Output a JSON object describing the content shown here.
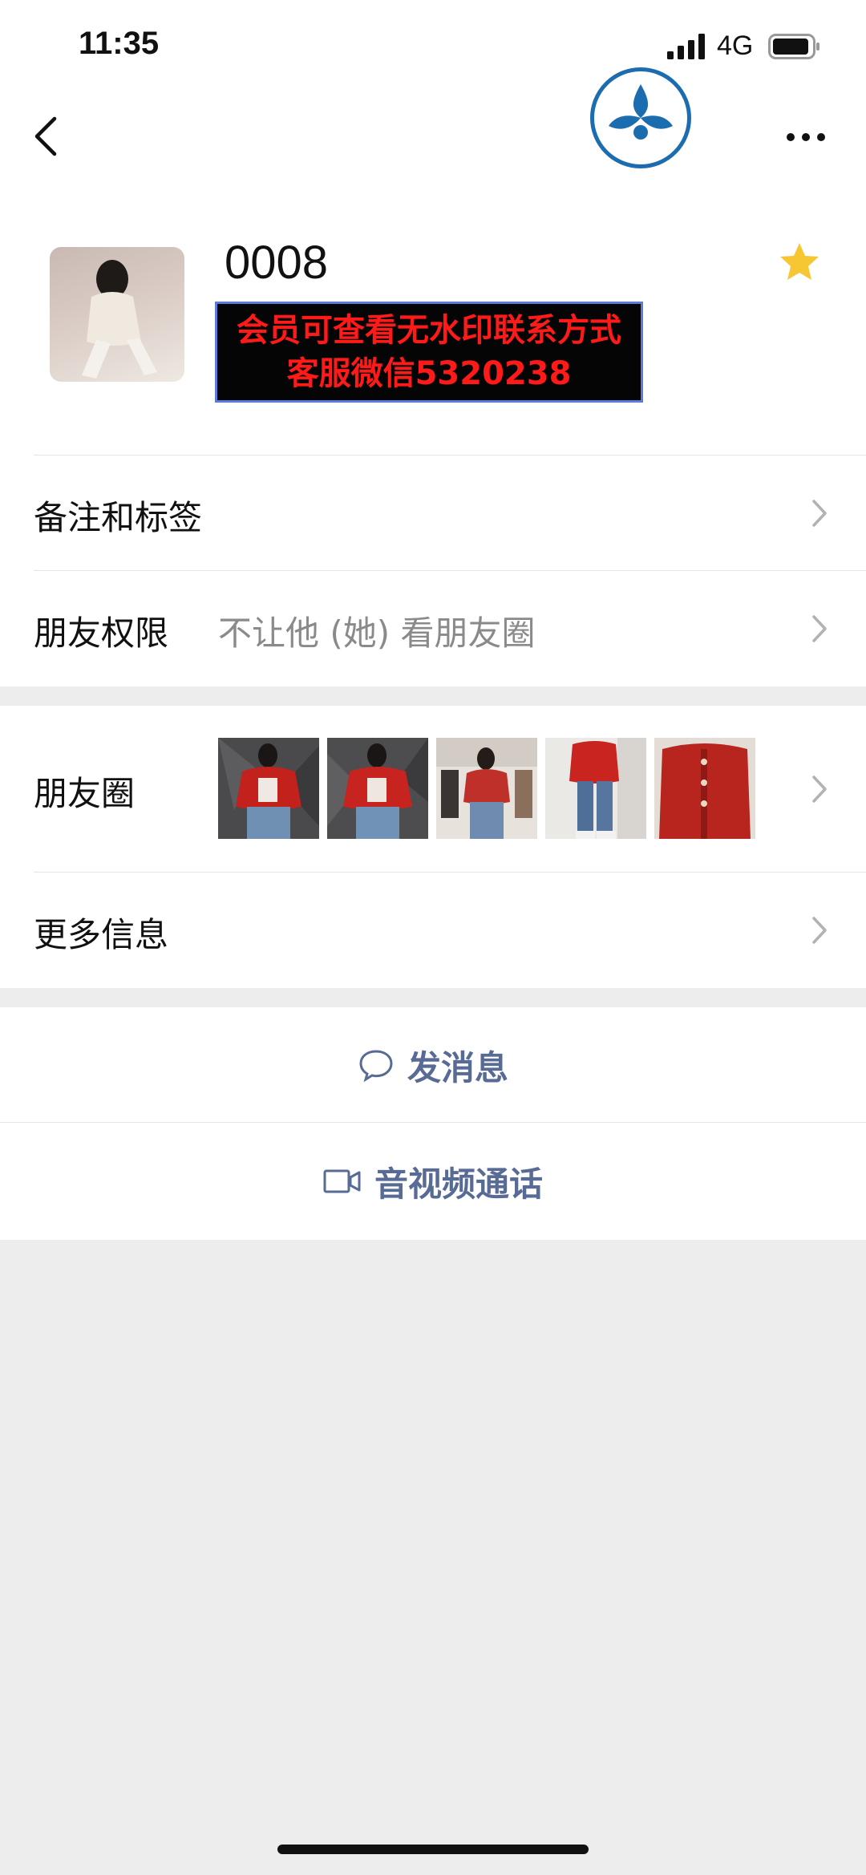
{
  "status_bar": {
    "time": "11:35",
    "network": "4G",
    "icons": [
      "signal-icon",
      "battery-icon"
    ]
  },
  "nav": {
    "icons": [
      "back-icon",
      "logo-badge",
      "more-icon"
    ]
  },
  "profile": {
    "name": "0008",
    "starred": true,
    "watermark": {
      "line1": "会员可查看无水印联系方式",
      "line2": "客服微信5320238"
    }
  },
  "rows": {
    "remark": {
      "label": "备注和标签"
    },
    "permission": {
      "label": "朋友权限",
      "value": "不让他 (她) 看朋友圈"
    },
    "moments": {
      "label": "朋友圈",
      "thumbnail_count": 5
    },
    "more": {
      "label": "更多信息"
    }
  },
  "actions": {
    "message": {
      "label": "发消息",
      "icon": "chat-bubble-icon"
    },
    "call": {
      "label": "音视频通话",
      "icon": "video-camera-icon"
    }
  },
  "colors": {
    "link_blue": "#576b95",
    "watermark_red": "#ff1a1a",
    "star_yellow": "#f7c633",
    "background_gray": "#ededed"
  }
}
